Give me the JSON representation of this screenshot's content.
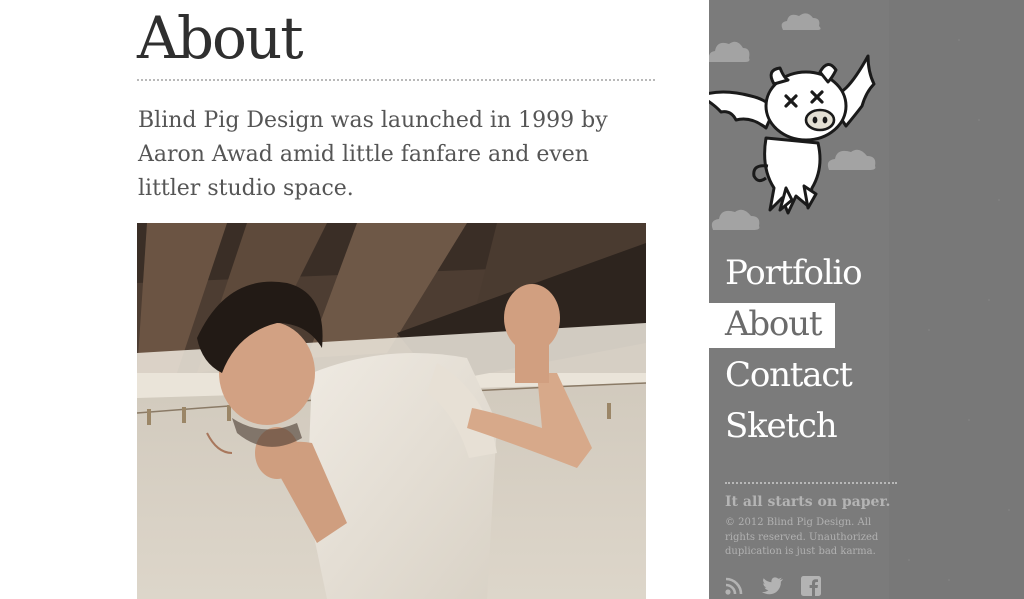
{
  "page": {
    "title": "About",
    "intro": "Blind Pig Design was launched in 1999 by Aaron Awad amid little fanfare and even littler studio space."
  },
  "sidebar": {
    "nav": [
      {
        "label": "Portfolio",
        "active": false
      },
      {
        "label": "About",
        "active": true
      },
      {
        "label": "Contact",
        "active": false
      },
      {
        "label": "Sketch",
        "active": false
      }
    ],
    "tagline": "It all starts on paper.",
    "copyright": "© 2012 Blind Pig Design. All rights reserved. Unauthorized duplication is just bad karma.",
    "social": [
      "rss-icon",
      "twitter-icon",
      "facebook-icon"
    ]
  },
  "colors": {
    "sidebar_bg": "#7b7b7b",
    "title_text": "#2f2f2f",
    "body_text": "#555555",
    "nav_text": "#ffffff",
    "active_highlight": "#ffffff"
  }
}
